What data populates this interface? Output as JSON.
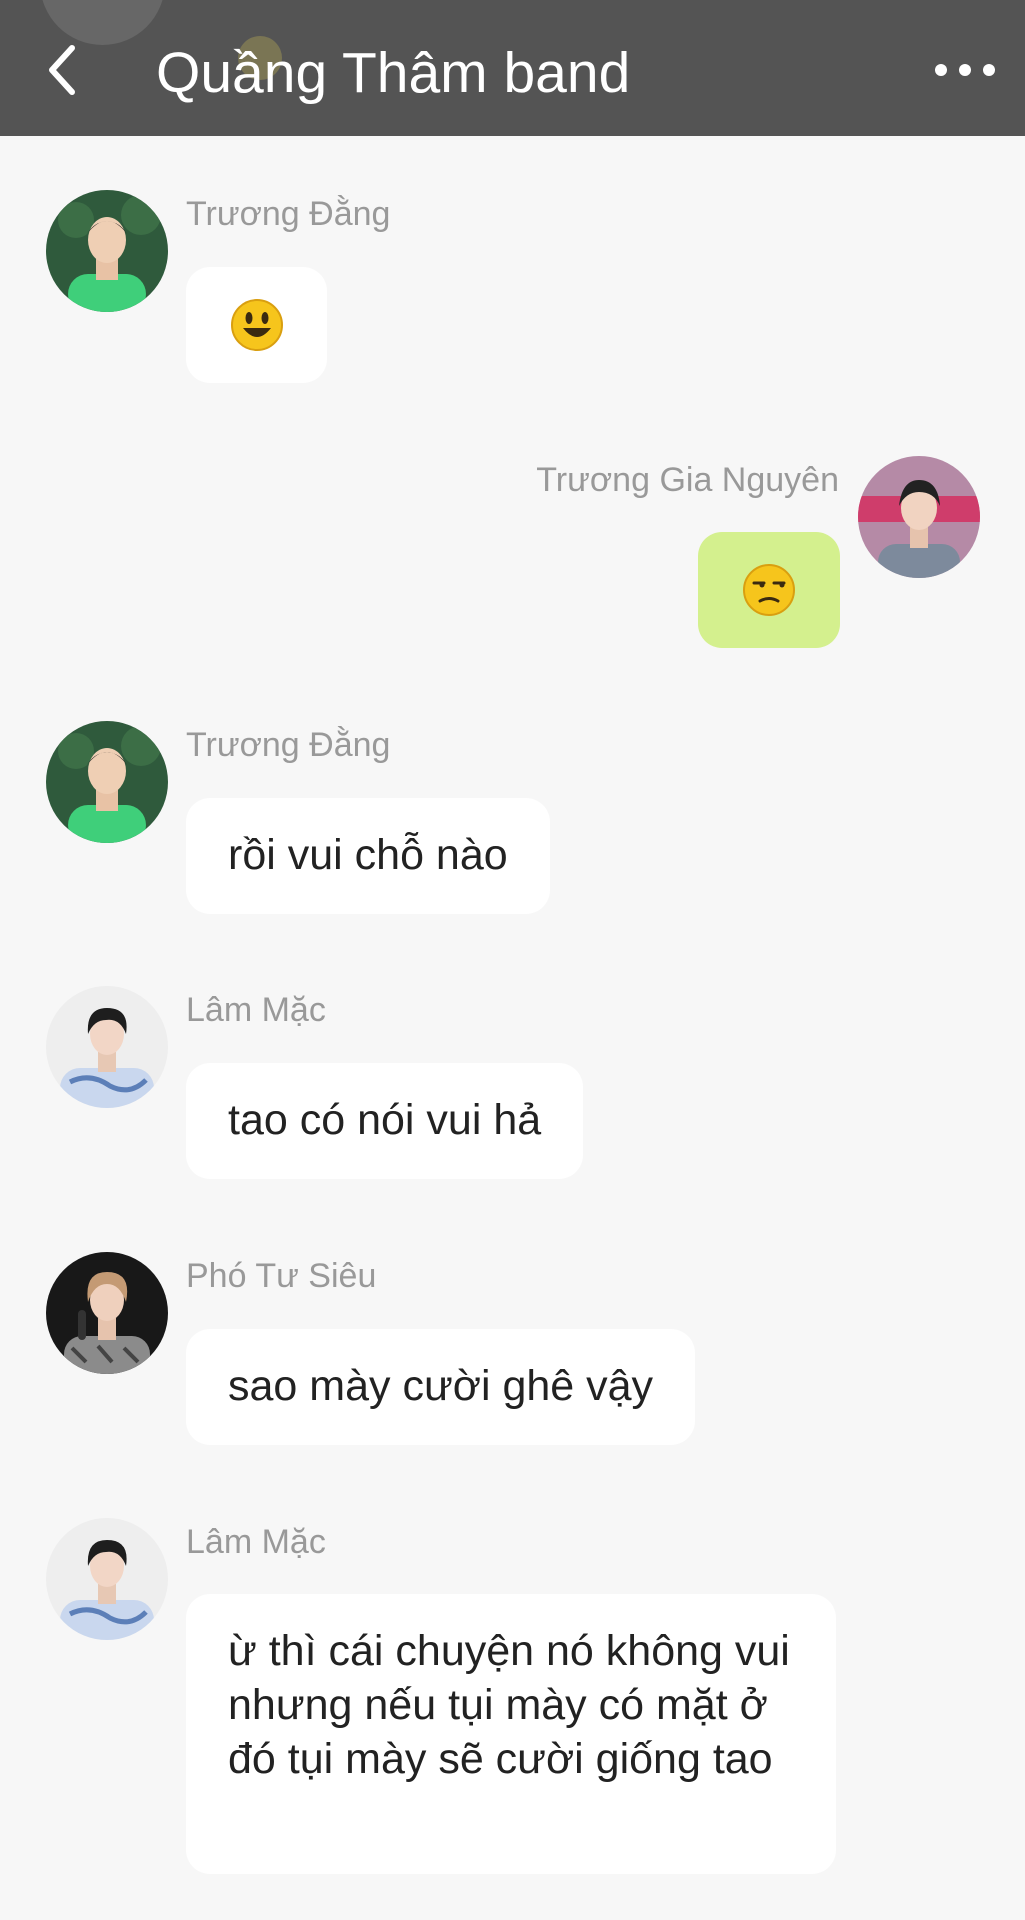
{
  "header": {
    "title": "Quầng Thâm band"
  },
  "messages": [
    {
      "sender": "Trương Đằng",
      "text": "😃",
      "side": "left",
      "avatar": "green-shirt-boy-avatar"
    },
    {
      "sender": "Trương Gia Nguyên",
      "text": "😒",
      "side": "right",
      "avatar": "stage-boy-avatar"
    },
    {
      "sender": "Trương Đằng",
      "text": "rồi vui chỗ nào",
      "side": "left",
      "avatar": "green-shirt-boy-avatar"
    },
    {
      "sender": "Lâm Mặc",
      "text": "tao có nói vui hả",
      "side": "left",
      "avatar": "tie-dye-shirt-boy-avatar"
    },
    {
      "sender": "Phó Tư Siêu",
      "text": "sao mày cười ghê vậy",
      "side": "left",
      "avatar": "microphone-boy-avatar"
    },
    {
      "sender": "Lâm Mặc",
      "text": "ừ thì cái chuyện nó không vui nhưng nếu tụi mày có mặt ở đó tụi mày sẽ cười giống tao",
      "side": "left",
      "avatar": "tie-dye-shirt-boy-avatar"
    }
  ],
  "colors": {
    "header_bg": "#545454",
    "page_bg": "#f7f7f7",
    "incoming_bubble": "#ffffff",
    "outgoing_bubble": "#d4f08e",
    "sender_name": "#999999"
  }
}
